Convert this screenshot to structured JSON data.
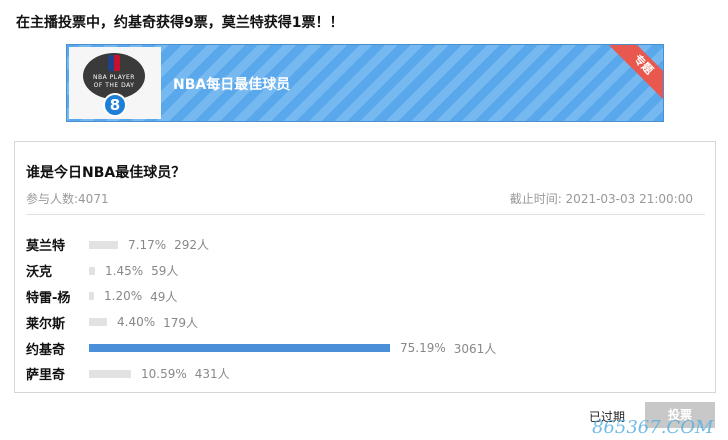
{
  "intro_text": "在主播投票中，约基奇获得9票，莫兰特获得1票！！",
  "banner": {
    "title": "NBA每日最佳球员",
    "badge": "专题",
    "logo_line1": "NBA PLAYER",
    "logo_line2": "OF THE DAY",
    "logo_number": "8",
    "stripe_colors": [
      "#5aa8ec",
      "#76b9f1"
    ]
  },
  "poll": {
    "question": "谁是今日NBA最佳球员？",
    "participants_text": "参与人数:4071",
    "deadline_text": "截止时间: 2021-03-03 21:00:00",
    "accent_color": "#4a90d9",
    "options": [
      {
        "name": "莫兰特",
        "percent": "7.17%",
        "count": "292人",
        "share": 0.0717
      },
      {
        "name": "沃克",
        "percent": "1.45%",
        "count": "59人",
        "share": 0.0145
      },
      {
        "name": "特雷-杨",
        "percent": "1.20%",
        "count": "49人",
        "share": 0.012
      },
      {
        "name": "莱尔斯",
        "percent": "4.40%",
        "count": "179人",
        "share": 0.044
      },
      {
        "name": "约基奇",
        "percent": "75.19%",
        "count": "3061人",
        "share": 0.7519,
        "leader": true
      },
      {
        "name": "萨里奇",
        "percent": "10.59%",
        "count": "431人",
        "share": 0.1059
      }
    ]
  },
  "footer": {
    "status_text": "已过期",
    "vote_label": "投票"
  },
  "watermark": "865367.COM"
}
